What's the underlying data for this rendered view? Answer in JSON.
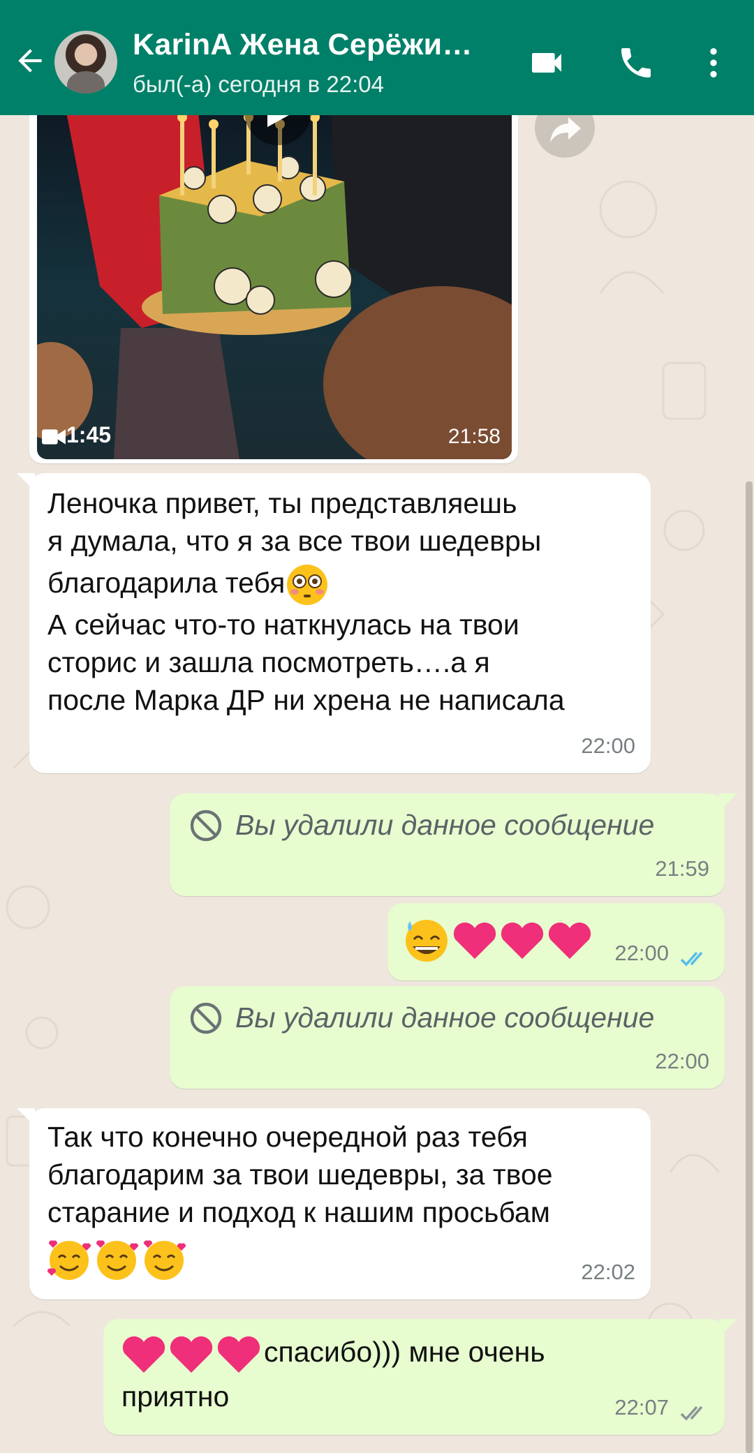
{
  "header": {
    "contact_name": "KarinA Жена Серёжи…",
    "status": "был(-а) сегодня в 22:04",
    "bg_color": "#008069"
  },
  "icons": [
    "back-arrow-icon",
    "video-call-icon",
    "phone-icon",
    "more-vertical-icon",
    "play-icon",
    "forward-icon",
    "video-camera-icon",
    "deleted-icon",
    "double-check-icon"
  ],
  "messages": {
    "video": {
      "duration": "1:45",
      "time": "21:58"
    },
    "m1": {
      "line1": "Леночка привет, ты представляешь",
      "line2": "я думала, что я за все твои шедевры",
      "line3": "благодарила тебя",
      "line4": "А сейчас что-то наткнулась на твои",
      "line5": "сторис и зашла посмотреть….а я",
      "line6": "после Марка ДР ни хрена не написала",
      "time": "22:00"
    },
    "m2": {
      "text": "Вы удалили данное сообщение",
      "time": "21:59"
    },
    "m3": {
      "time": "22:00",
      "read_color": "#53bdeb"
    },
    "m4": {
      "text": "Вы удалили данное сообщение",
      "time": "22:00"
    },
    "m5": {
      "line1": "Так что конечно очередной раз тебя",
      "line2": "благодарим за твои шедевры, за твое",
      "line3": "старание и подход к нашим просьбам",
      "time": "22:02"
    },
    "m6": {
      "text1": "спасибо))) мне очень",
      "text2": "приятно",
      "time": "22:07",
      "tick_color": "#8a9599"
    }
  }
}
